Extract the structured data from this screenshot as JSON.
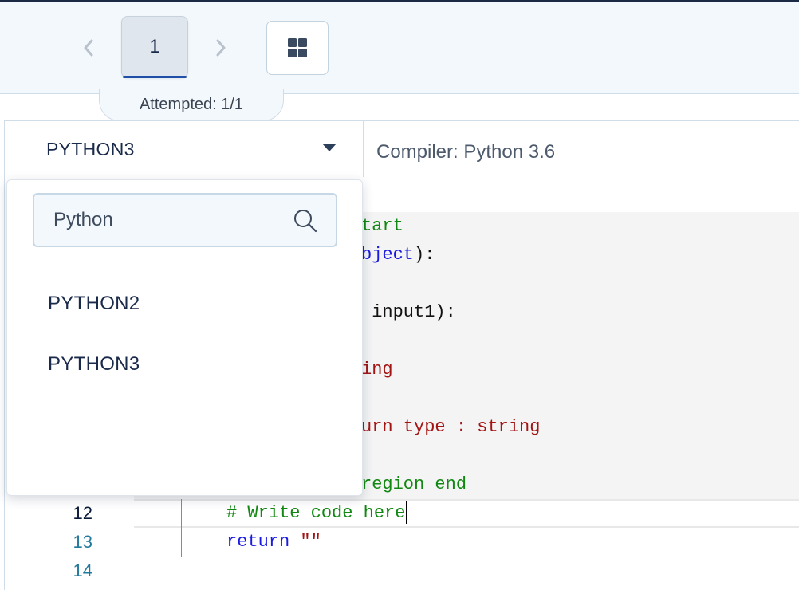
{
  "navigator": {
    "question_number": "1",
    "attempted_label": "Attempted: 1/1"
  },
  "editor": {
    "selected_language": "PYTHON3",
    "compiler_label": "Compiler: Python 3.6"
  },
  "language_dropdown": {
    "search_value": "Python",
    "options": [
      "PYTHON2",
      "PYTHON3"
    ]
  },
  "code_lines": [
    {
      "text": "tart",
      "color": "#118811"
    },
    {
      "parts": [
        {
          "text": "bject",
          "color": "#1a1ae0"
        },
        {
          "text": "):",
          "color": "#111111"
        }
      ]
    },
    {
      "text": " input1):",
      "color": "#111111"
    },
    {
      "text": "ing",
      "color": "#a31515"
    },
    {
      "text": "urn type : string",
      "color": "#a31515"
    },
    {
      "text": "region end",
      "color": "#118811"
    },
    {
      "text": "# Write code here",
      "color": "#118811"
    },
    {
      "keyword": "return",
      "string": "\"\""
    }
  ],
  "line_numbers": [
    "12",
    "13",
    "14"
  ],
  "colors": {
    "accent": "#1f4fa8",
    "comment": "#118811",
    "keyword": "#1a1ae0",
    "string": "#a31515",
    "line_number": "#217a9c"
  },
  "icons": {
    "prev": "chevron-left-icon",
    "next": "chevron-right-icon",
    "grid": "grid-icon",
    "search": "search-icon",
    "caret": "caret-down-icon"
  }
}
